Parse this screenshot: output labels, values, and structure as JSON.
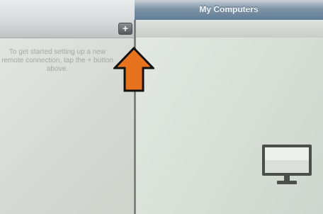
{
  "window": {
    "title": "My Computers"
  },
  "toolbar": {
    "add_button_label": "+"
  },
  "left_panel": {
    "help_text": "To get started setting up a new remote connection, tap the + button above."
  },
  "icons": {
    "add": "plus-icon",
    "arrow": "up-arrow-icon",
    "monitor": "monitor-icon"
  },
  "colors": {
    "arrow_fill": "#e8731f",
    "arrow_stroke": "#111111",
    "title_bar": "#6f889e"
  }
}
